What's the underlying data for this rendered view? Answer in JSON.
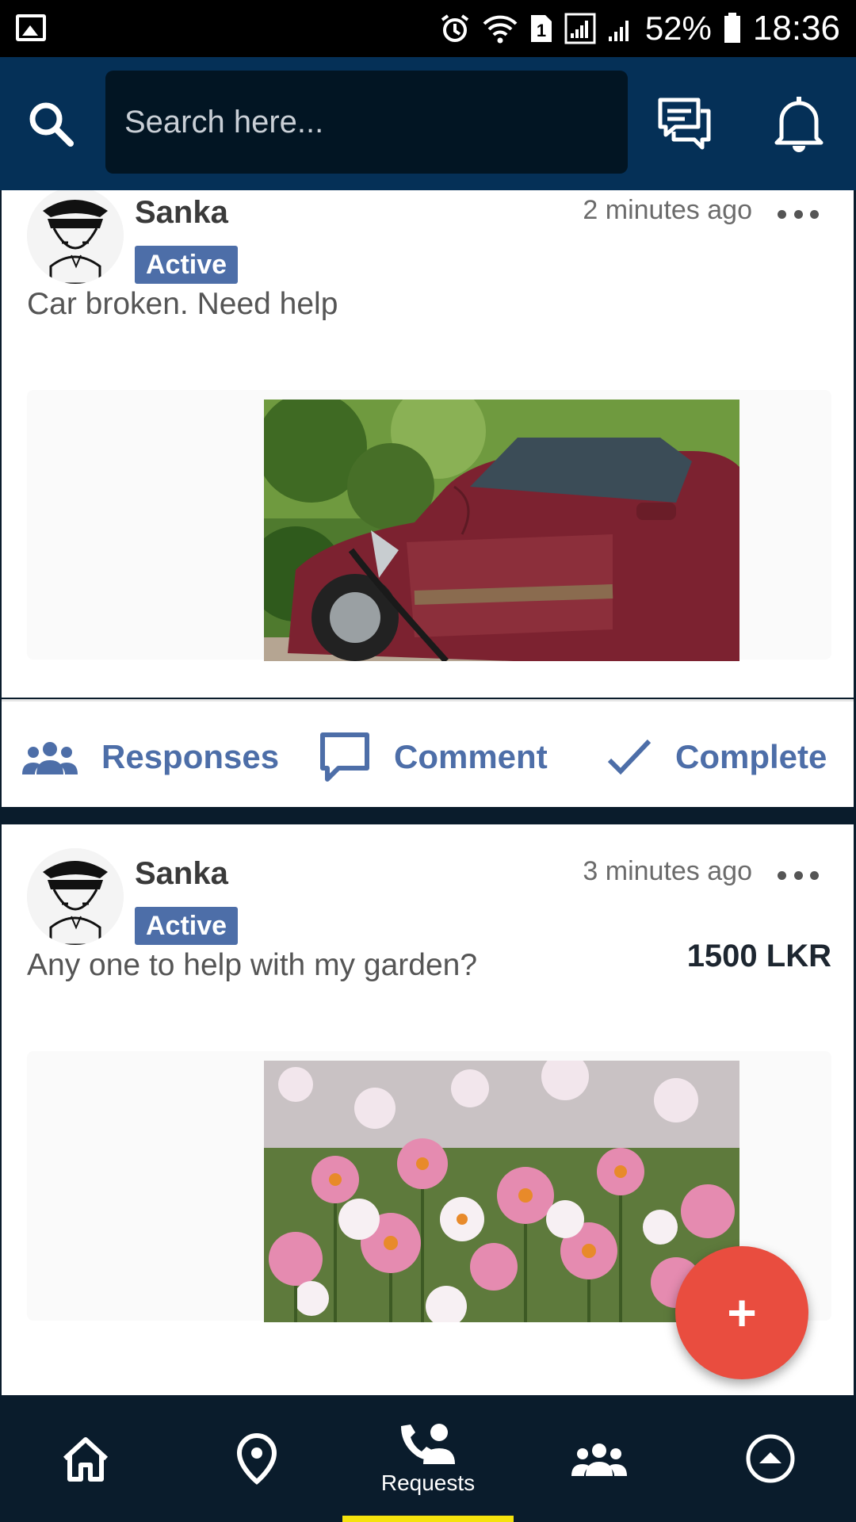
{
  "status_bar": {
    "sim_slot": "1",
    "battery": "52%",
    "time": "18:36"
  },
  "header": {
    "search_placeholder": "Search here..."
  },
  "posts": [
    {
      "user": "Sanka",
      "status": "Active",
      "time": "2 minutes ago",
      "text": "Car broken. Need help",
      "price": "",
      "image": "damaged red car photo"
    },
    {
      "user": "Sanka",
      "status": "Active",
      "time": "3 minutes ago",
      "text": "Any one to help with my garden?",
      "price": "1500 LKR",
      "image": "pink daisy flower field photo"
    }
  ],
  "actions": {
    "responses": "Responses",
    "comment": "Comment",
    "complete": "Complete"
  },
  "fab": {
    "label": "+"
  },
  "bottom_nav": {
    "active": "Requests",
    "items": [
      "home-icon",
      "location-pin-icon",
      "Requests",
      "group-icon",
      "profile-icon"
    ]
  },
  "colors": {
    "app_bar": "#053057",
    "accent": "#4d6ea8",
    "fab": "#e94d3f",
    "nav_indicator": "#f5e20d"
  }
}
